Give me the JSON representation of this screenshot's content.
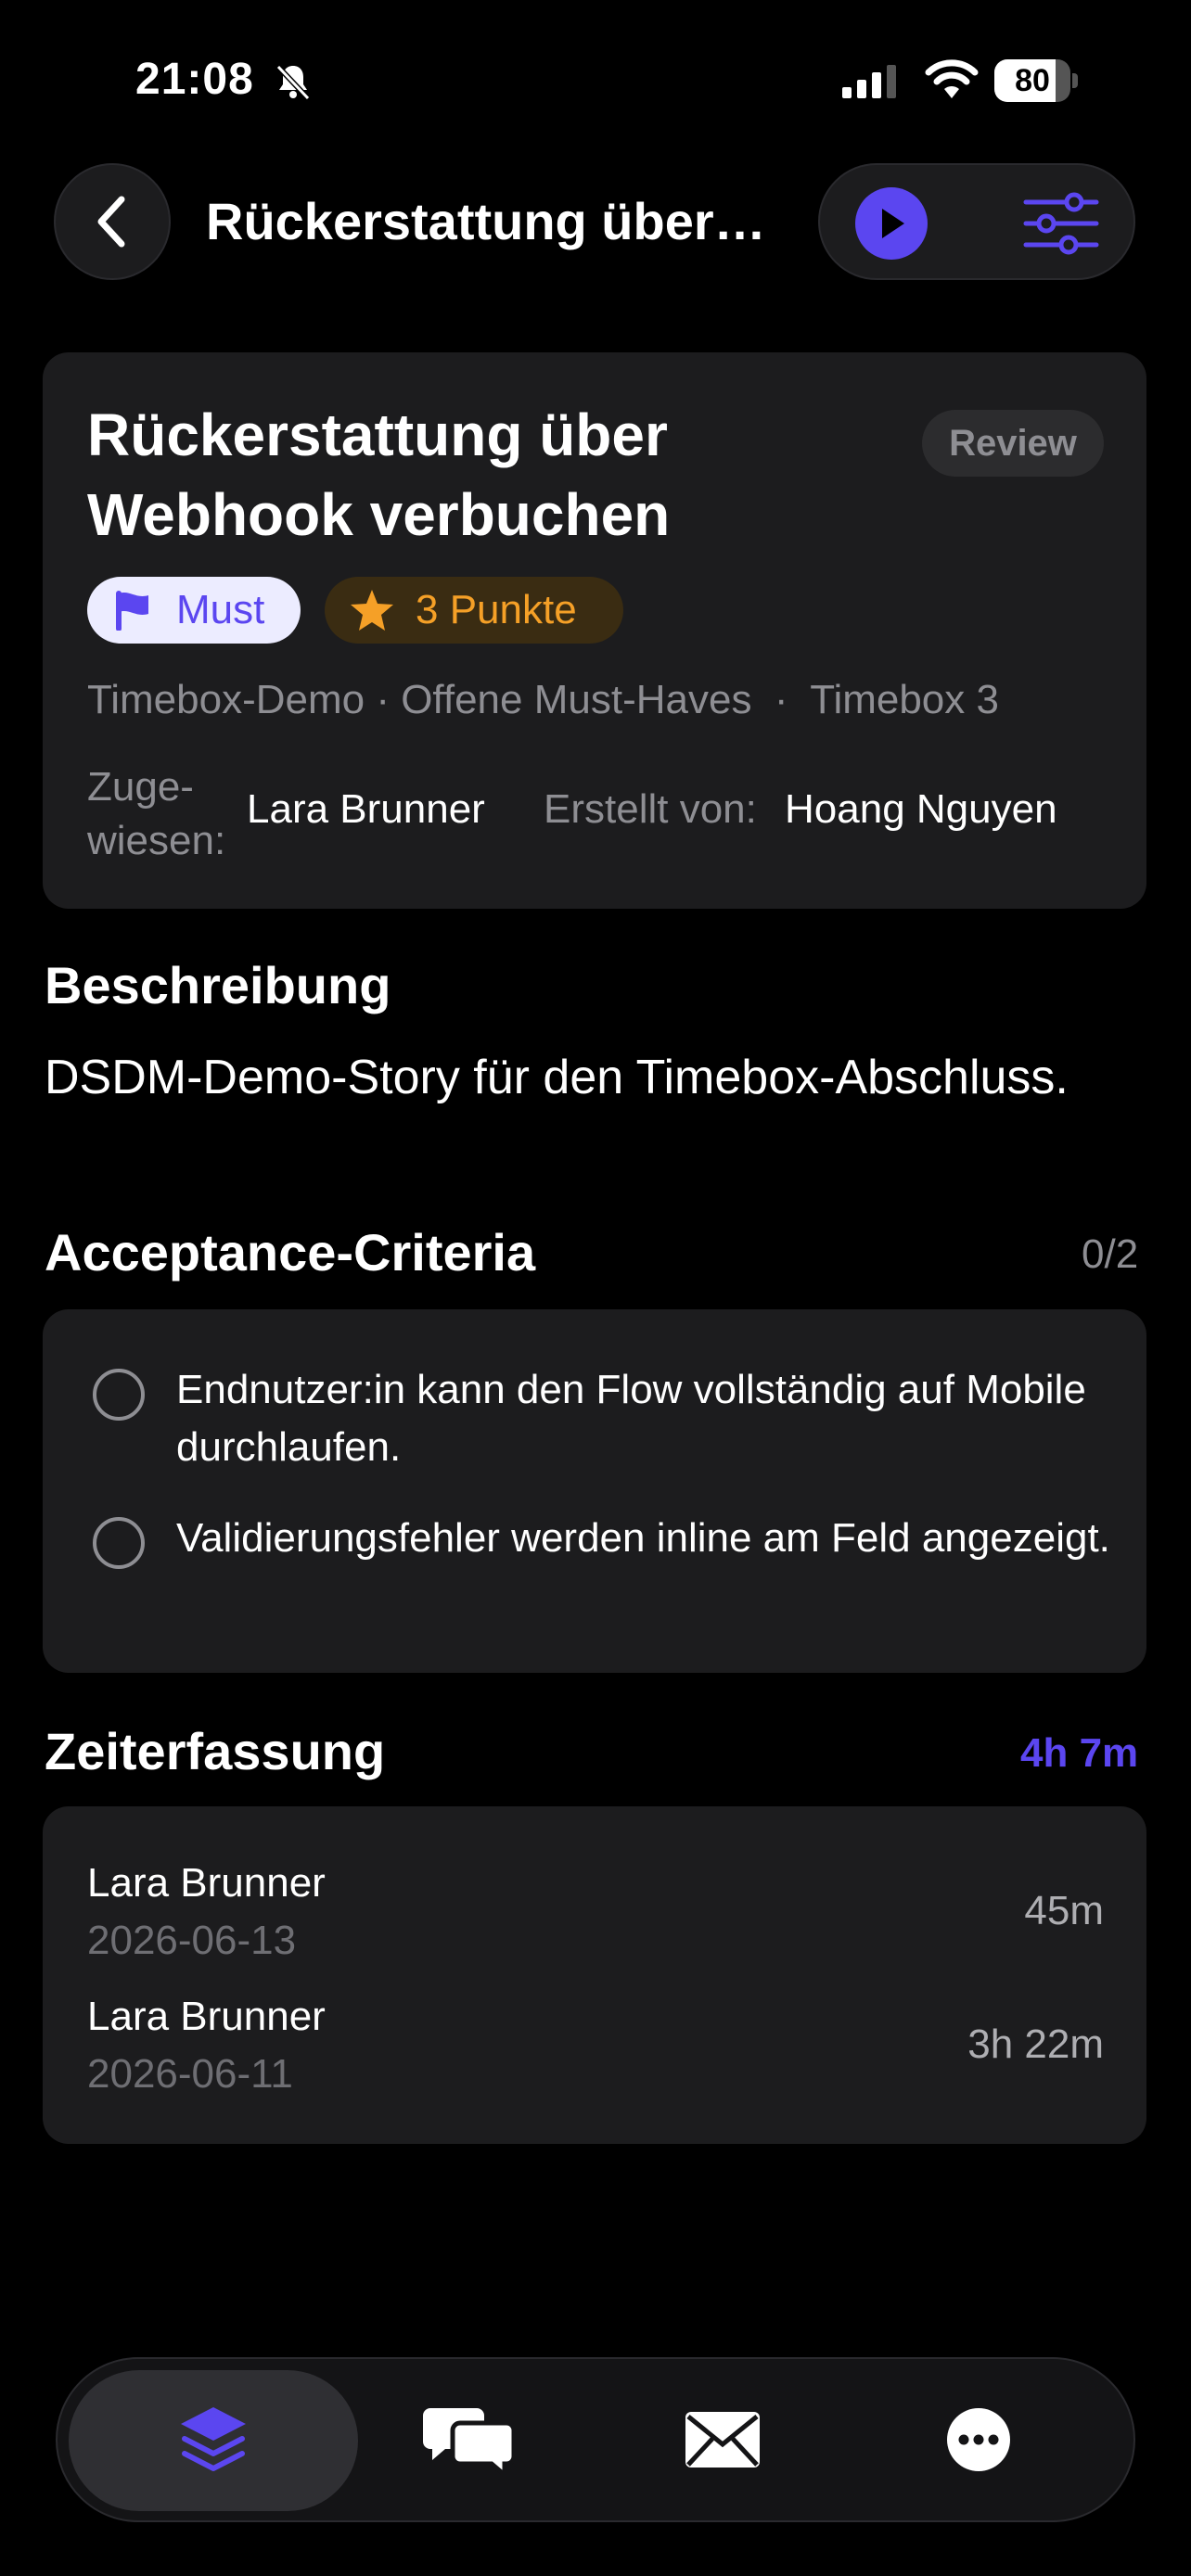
{
  "status_bar": {
    "time": "21:08",
    "battery": 80
  },
  "header": {
    "title": "Rückerstattung über…"
  },
  "story": {
    "title": "Rückerstattung über Webhook verbuchen",
    "status": "Review",
    "priority": "Must",
    "points_label": "3 Punkte",
    "breadcrumb": "Timebox-Demo · Offene Must-Haves  ·  Timebox 3",
    "assigned_label": "Zuge-\nwiesen:",
    "assignee": "Lara Brunner",
    "created_by_label": "Erstellt von:",
    "creator": "Hoang Nguyen"
  },
  "description": {
    "heading": "Beschreibung",
    "text": "DSDM-Demo-Story für den Timebox-Abschluss."
  },
  "criteria": {
    "heading": "Acceptance-Criteria",
    "count": "0/2",
    "items": [
      {
        "text": "Endnutzer:in kann den Flow vollständig auf Mobile durchlaufen."
      },
      {
        "text": "Validierungsfehler werden inline am Feld angezeigt."
      }
    ]
  },
  "time_tracking": {
    "heading": "Zeiterfassung",
    "total": "4h 7m",
    "entries": [
      {
        "name": "Lara Brunner",
        "date": "2026-06-13",
        "duration": "45m"
      },
      {
        "name": "Lara Brunner",
        "date": "2026-06-11",
        "duration": "3h 22m"
      }
    ]
  },
  "tabbar": {
    "tabs": [
      {
        "icon": "layers-icon",
        "active": true
      },
      {
        "icon": "chat-bubbles-icon",
        "active": false
      },
      {
        "icon": "mail-icon",
        "active": false
      },
      {
        "icon": "more-icon",
        "active": false
      }
    ]
  },
  "colors": {
    "accent": "#5b46f0",
    "points": "#f5a027",
    "background": "#000000",
    "card": "#1c1c1e"
  }
}
